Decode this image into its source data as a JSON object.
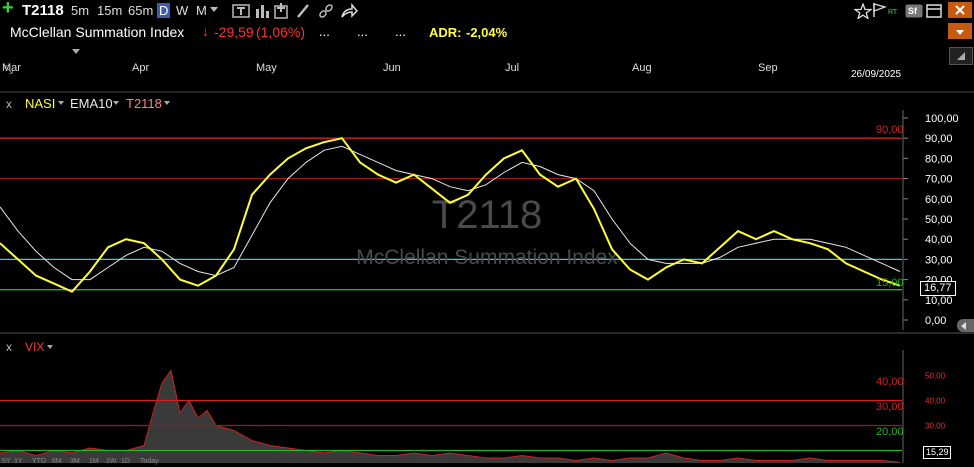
{
  "toolbar": {
    "plus_icon": "plus-icon",
    "symbol": "T2118",
    "timeframes": [
      "5m",
      "15m",
      "65m",
      "D",
      "W",
      "M"
    ],
    "selected_timeframe": "D",
    "right_icons": [
      "star-icon",
      "flag-icon",
      "rt-icon",
      "sf-icon",
      "window-icon",
      "close-icon"
    ]
  },
  "info": {
    "name": "McClellan Summation Index",
    "change": "-29,59",
    "change_pct": "(1,06%)",
    "placeholders": [
      "...",
      "...",
      "..."
    ],
    "adr_label": "ADR:",
    "adr_value": "-2,04%"
  },
  "months": [
    "Mar",
    "Apr",
    "May",
    "Jun",
    "Jul",
    "Aug",
    "Sep"
  ],
  "date_label": "26/09/2025",
  "panel1": {
    "close": "x",
    "legend": [
      "NASI",
      "EMA10",
      "T2118"
    ],
    "watermark_symbol": "T2118",
    "watermark_name": "McClellan Summation Index",
    "level_labels": [
      "90,00",
      "15,00"
    ],
    "current_value": "16,77",
    "yticks": [
      "100,00",
      "90,00",
      "80,00",
      "70,00",
      "60,00",
      "50,00",
      "40,00",
      "30,00",
      "20,00",
      "10,00",
      "0,00"
    ]
  },
  "panel2": {
    "close": "x",
    "legend": [
      "VIX"
    ],
    "level_labels": [
      "40,00",
      "30,00",
      "20,00"
    ],
    "current_value": "15,29",
    "yticks": [
      "50,00",
      "40,00",
      "30,00",
      "20,00"
    ]
  },
  "range_buttons": [
    "5Y",
    "1Y",
    "YTD",
    "6M",
    "3M",
    "1M",
    "1W",
    "1D",
    "Today"
  ],
  "colors": {
    "nasi": "#ffff33",
    "ema": "#e8e8e8",
    "level_red": "#d42020",
    "level_darkred": "#a01818",
    "level_cyan": "#40c8d8",
    "level_green": "#22b422",
    "change_red": "#ff3030",
    "adr_yellow": "#ffff40",
    "vix_fill": "#3a3a3a",
    "vix_line": "#cc2020"
  },
  "chart_data": [
    {
      "type": "line",
      "x_range": [
        "Mar",
        "26/09/2025"
      ],
      "ylim": [
        0,
        100
      ],
      "levels": [
        90,
        70,
        30,
        15
      ],
      "series": [
        {
          "name": "NASI",
          "x": [
            0,
            0.02,
            0.04,
            0.06,
            0.08,
            0.1,
            0.12,
            0.14,
            0.16,
            0.18,
            0.2,
            0.22,
            0.24,
            0.26,
            0.28,
            0.3,
            0.32,
            0.34,
            0.36,
            0.38,
            0.4,
            0.42,
            0.44,
            0.46,
            0.48,
            0.5,
            0.52,
            0.54,
            0.56,
            0.58,
            0.6,
            0.62,
            0.64,
            0.66,
            0.68,
            0.7,
            0.72,
            0.74,
            0.76,
            0.78,
            0.8,
            0.82,
            0.84,
            0.86,
            0.88,
            0.9,
            0.92,
            0.94,
            0.96,
            0.98,
            1.0
          ],
          "values": [
            38,
            30,
            22,
            18,
            14,
            24,
            36,
            40,
            38,
            30,
            20,
            17,
            22,
            35,
            62,
            72,
            80,
            85,
            88,
            90,
            78,
            72,
            68,
            72,
            65,
            58,
            62,
            72,
            80,
            84,
            72,
            66,
            70,
            55,
            35,
            25,
            20,
            26,
            30,
            28,
            36,
            44,
            40,
            44,
            40,
            38,
            35,
            28,
            24,
            20,
            17
          ]
        },
        {
          "name": "EMA10",
          "x": [
            0,
            0.02,
            0.04,
            0.06,
            0.08,
            0.1,
            0.12,
            0.14,
            0.16,
            0.18,
            0.2,
            0.22,
            0.24,
            0.26,
            0.28,
            0.3,
            0.32,
            0.34,
            0.36,
            0.38,
            0.4,
            0.42,
            0.44,
            0.46,
            0.48,
            0.5,
            0.52,
            0.54,
            0.56,
            0.58,
            0.6,
            0.62,
            0.64,
            0.66,
            0.68,
            0.7,
            0.72,
            0.74,
            0.76,
            0.78,
            0.8,
            0.82,
            0.84,
            0.86,
            0.88,
            0.9,
            0.92,
            0.94,
            0.96,
            0.98,
            1.0
          ],
          "values": [
            56,
            44,
            34,
            26,
            20,
            20,
            26,
            32,
            36,
            34,
            28,
            24,
            22,
            26,
            42,
            58,
            70,
            78,
            84,
            86,
            82,
            78,
            74,
            72,
            70,
            66,
            64,
            67,
            73,
            78,
            76,
            72,
            70,
            64,
            50,
            38,
            30,
            28,
            28,
            28,
            31,
            36,
            38,
            40,
            40,
            40,
            38,
            36,
            32,
            28,
            24
          ]
        }
      ]
    },
    {
      "type": "area",
      "ylim": [
        15,
        55
      ],
      "levels": [
        40,
        30,
        20
      ],
      "series": [
        {
          "name": "VIX",
          "x": [
            0,
            0.02,
            0.04,
            0.06,
            0.08,
            0.1,
            0.12,
            0.14,
            0.16,
            0.17,
            0.18,
            0.19,
            0.2,
            0.21,
            0.22,
            0.23,
            0.24,
            0.26,
            0.28,
            0.3,
            0.32,
            0.34,
            0.36,
            0.38,
            0.4,
            0.42,
            0.44,
            0.46,
            0.48,
            0.5,
            0.52,
            0.54,
            0.56,
            0.58,
            0.6,
            0.62,
            0.64,
            0.66,
            0.68,
            0.7,
            0.72,
            0.74,
            0.76,
            0.78,
            0.8,
            0.82,
            0.84,
            0.86,
            0.88,
            0.9,
            0.92,
            0.94,
            0.96,
            0.98,
            1.0
          ],
          "values": [
            19,
            20,
            18,
            20,
            19,
            21,
            20,
            20,
            22,
            35,
            47,
            52,
            35,
            40,
            33,
            36,
            30,
            28,
            24,
            22,
            21,
            20,
            19,
            20,
            19,
            18,
            18,
            19,
            18,
            19,
            18,
            17,
            17,
            18,
            17,
            17,
            16,
            17,
            16,
            17,
            17,
            19,
            17,
            16,
            16,
            17,
            16,
            16,
            16,
            17,
            16,
            16,
            16,
            16,
            15.3
          ]
        }
      ]
    }
  ]
}
